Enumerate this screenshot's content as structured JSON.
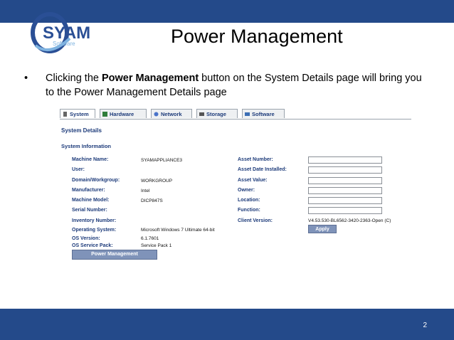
{
  "slide": {
    "title": "Power Management",
    "bullet_marker": "•",
    "bullet_parts": {
      "before": "Clicking the ",
      "bold": "Power Management",
      "after": " button on the System Details page will bring you to the Power Management Details page"
    },
    "page_number": "2"
  },
  "logo": {
    "text_main": "SYAM",
    "text_sub": "Software",
    "colors": {
      "ring": "#2a4f95",
      "accent": "#7fb3e0"
    }
  },
  "colors": {
    "bar": "#244a8a",
    "label": "#1d3b7a",
    "button": "#7f93b9"
  },
  "tabs": [
    {
      "label": "System",
      "icon": "computer-icon"
    },
    {
      "label": "Hardware",
      "icon": "hardware-icon"
    },
    {
      "label": "Network",
      "icon": "network-icon"
    },
    {
      "label": "Storage",
      "icon": "storage-icon"
    },
    {
      "label": "Software",
      "icon": "software-icon"
    }
  ],
  "section_title": "System Details",
  "subsection_title": "System Information",
  "left_fields": [
    {
      "label": "Machine Name:",
      "value": "SYAMAPPLIANCE3"
    },
    {
      "label": "User:",
      "value": ""
    },
    {
      "label": "Domain/Workgroup:",
      "value": "WORKGROUP"
    },
    {
      "label": "Manufacturer:",
      "value": "Intel"
    },
    {
      "label": "Machine Model:",
      "value": "DICP847S"
    },
    {
      "label": "Serial Number:",
      "value": ""
    },
    {
      "label": "Inventory Number:",
      "value": ""
    },
    {
      "label": "Operating System:",
      "value": "Microsoft Windows 7 Ultimate 64-bit"
    },
    {
      "label": "OS Version:",
      "value": "6.1.7601"
    },
    {
      "label": "OS Service Pack:",
      "value": "Service Pack 1"
    }
  ],
  "right_fields": [
    {
      "label": "Asset Number:",
      "value": ""
    },
    {
      "label": "Asset Date Installed:",
      "value": ""
    },
    {
      "label": "Asset Value:",
      "value": ""
    },
    {
      "label": "Owner:",
      "value": ""
    },
    {
      "label": "Location:",
      "value": ""
    },
    {
      "label": "Function:",
      "value": ""
    },
    {
      "label": "Client Version:",
      "value": "V4.53.530-BL6562-3420-2363-Open (C)"
    }
  ],
  "apply_label": "Apply",
  "power_management_button": "Power Management"
}
